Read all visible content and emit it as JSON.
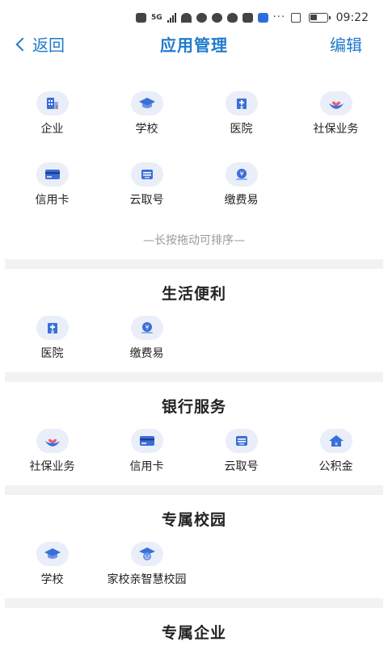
{
  "status_bar": {
    "network": "5G",
    "time": "09:22",
    "more": "···"
  },
  "nav": {
    "back_label": "返回",
    "title": "应用管理",
    "edit_label": "编辑"
  },
  "my_apps": [
    {
      "label": "企业",
      "icon": "building-icon"
    },
    {
      "label": "学校",
      "icon": "graduation-cap-icon"
    },
    {
      "label": "医院",
      "icon": "hospital-icon"
    },
    {
      "label": "社保业务",
      "icon": "heart-hands-icon"
    },
    {
      "label": "信用卡",
      "icon": "credit-card-icon"
    },
    {
      "label": "云取号",
      "icon": "ticket-icon"
    },
    {
      "label": "缴费易",
      "icon": "payment-icon"
    }
  ],
  "hint": "—长按拖动可排序—",
  "sections": [
    {
      "title": "生活便利",
      "items": [
        {
          "label": "医院",
          "icon": "hospital-icon"
        },
        {
          "label": "缴费易",
          "icon": "payment-icon"
        }
      ]
    },
    {
      "title": "银行服务",
      "items": [
        {
          "label": "社保业务",
          "icon": "heart-hands-icon"
        },
        {
          "label": "信用卡",
          "icon": "credit-card-icon"
        },
        {
          "label": "云取号",
          "icon": "ticket-icon"
        },
        {
          "label": "公积金",
          "icon": "house-fund-icon"
        }
      ]
    },
    {
      "title": "专属校园",
      "items": [
        {
          "label": "学校",
          "icon": "graduation-cap-icon"
        },
        {
          "label": "家校亲智慧校园",
          "icon": "smart-campus-icon"
        }
      ]
    },
    {
      "title": "专属企业",
      "items": []
    }
  ],
  "colors": {
    "accent": "#1f7acc",
    "icon_bg": "#e9eef8",
    "icon_fg": "#3b6fd8",
    "divider": "#f1f2f4"
  }
}
